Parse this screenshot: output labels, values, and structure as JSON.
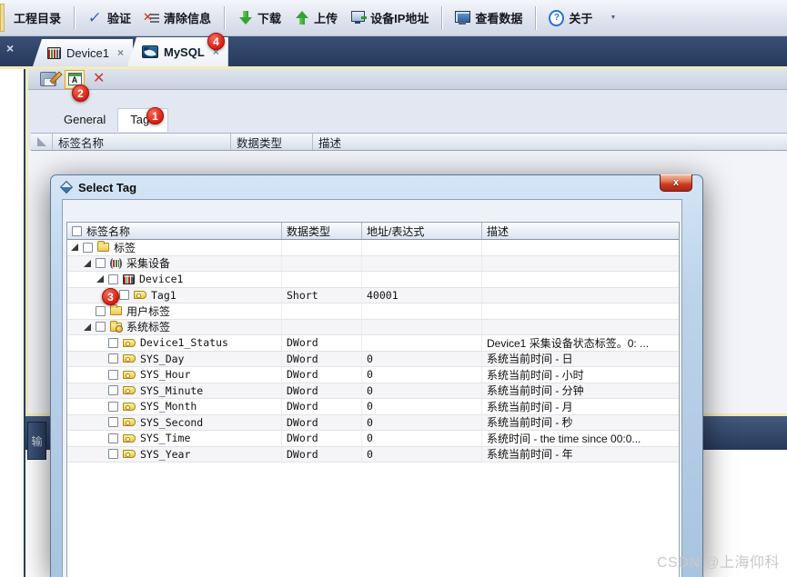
{
  "colors": {
    "badge-red": "#d91f11",
    "navy": "#2b3d5e",
    "cream": "#f2ecba",
    "glass": "#bdd3ea",
    "close-red": "#cd3a24",
    "sel-yellow": "#f5e9a8"
  },
  "toolbar": {
    "items": [
      {
        "id": "project-dir",
        "icon": "none",
        "label": "工程目录"
      },
      {
        "type": "sep"
      },
      {
        "id": "validate",
        "icon": "check",
        "label": "验证"
      },
      {
        "id": "clear-info",
        "icon": "clear",
        "label": "清除信息"
      },
      {
        "type": "sep"
      },
      {
        "id": "download",
        "icon": "arrow-down",
        "label": "下载"
      },
      {
        "id": "upload",
        "icon": "arrow-up",
        "label": "上传"
      },
      {
        "id": "device-ip",
        "icon": "device-ip",
        "label": "设备IP地址"
      },
      {
        "type": "sep"
      },
      {
        "id": "view-data",
        "icon": "monitor",
        "label": "查看数据"
      },
      {
        "type": "sep"
      },
      {
        "id": "about",
        "icon": "help",
        "label": "关于"
      },
      {
        "id": "more",
        "icon": "caret",
        "label": ""
      }
    ]
  },
  "panel_close": "×",
  "document_tabs": [
    {
      "id": "device1",
      "icon": "rack",
      "label": "Device1",
      "close": "×"
    },
    {
      "id": "mysql",
      "icon": "mysql",
      "label": "MySQL",
      "close": "×"
    }
  ],
  "editor": {
    "tabs": {
      "general": "General",
      "tags": "Tags"
    },
    "table_columns": [
      "标签名称",
      "数据类型",
      "描述"
    ]
  },
  "bottom_panel": {
    "tab_label": "输"
  },
  "dialog": {
    "title": "Select Tag",
    "close_label": "x",
    "table": {
      "columns": [
        "标签名称",
        "数据类型",
        "地址/表达式",
        "描述"
      ],
      "rows": [
        {
          "name": "标签",
          "level": 0,
          "icon": "folder",
          "expander": true,
          "dtype": "",
          "addr": "",
          "desc": "",
          "shaded": false
        },
        {
          "name": "采集设备",
          "level": 1,
          "icon": "device-group",
          "expander": true,
          "dtype": "",
          "addr": "",
          "desc": "",
          "shaded": true
        },
        {
          "name": "Device1",
          "level": 2,
          "icon": "rack",
          "expander": true,
          "dtype": "",
          "addr": "",
          "desc": "",
          "shaded": false
        },
        {
          "name": "Tag1",
          "level": 3,
          "icon": "tag",
          "connector": true,
          "dtype": "Short",
          "addr": "40001",
          "desc": "",
          "shaded": true
        },
        {
          "name": "用户标签",
          "level": 1,
          "icon": "folder",
          "dtype": "",
          "addr": "",
          "desc": "",
          "shaded": false
        },
        {
          "name": "系统标签",
          "level": 1,
          "icon": "folder-sys",
          "expander": true,
          "dtype": "",
          "addr": "",
          "desc": "",
          "shaded": true
        },
        {
          "name": "Device1_Status",
          "level": 2,
          "icon": "tag",
          "dtype": "DWord",
          "addr": "",
          "desc": "Device1 采集设备状态标签。0: ...",
          "shaded": false
        },
        {
          "name": "SYS_Day",
          "level": 2,
          "icon": "tag",
          "dtype": "DWord",
          "addr": "0",
          "desc": "系统当前时间 - 日",
          "shaded": true
        },
        {
          "name": "SYS_Hour",
          "level": 2,
          "icon": "tag",
          "dtype": "DWord",
          "addr": "0",
          "desc": "系统当前时间 - 小时",
          "shaded": false
        },
        {
          "name": "SYS_Minute",
          "level": 2,
          "icon": "tag",
          "dtype": "DWord",
          "addr": "0",
          "desc": "系统当前时间 - 分钟",
          "shaded": true
        },
        {
          "name": "SYS_Month",
          "level": 2,
          "icon": "tag",
          "dtype": "DWord",
          "addr": "0",
          "desc": "系统当前时间 - 月",
          "shaded": false
        },
        {
          "name": "SYS_Second",
          "level": 2,
          "icon": "tag",
          "dtype": "DWord",
          "addr": "0",
          "desc": "系统当前时间 - 秒",
          "shaded": true
        },
        {
          "name": "SYS_Time",
          "level": 2,
          "icon": "tag",
          "dtype": "DWord",
          "addr": "0",
          "desc": "系统时间 - the time since 00:0...",
          "shaded": false
        },
        {
          "name": "SYS_Year",
          "level": 2,
          "icon": "tag",
          "dtype": "DWord",
          "addr": "0",
          "desc": "系统当前时间 - 年",
          "shaded": true
        }
      ]
    }
  },
  "badges": {
    "step1": "1",
    "step2": "2",
    "step3": "3",
    "step4": "4"
  },
  "watermark": "CSDN @上海仰科"
}
